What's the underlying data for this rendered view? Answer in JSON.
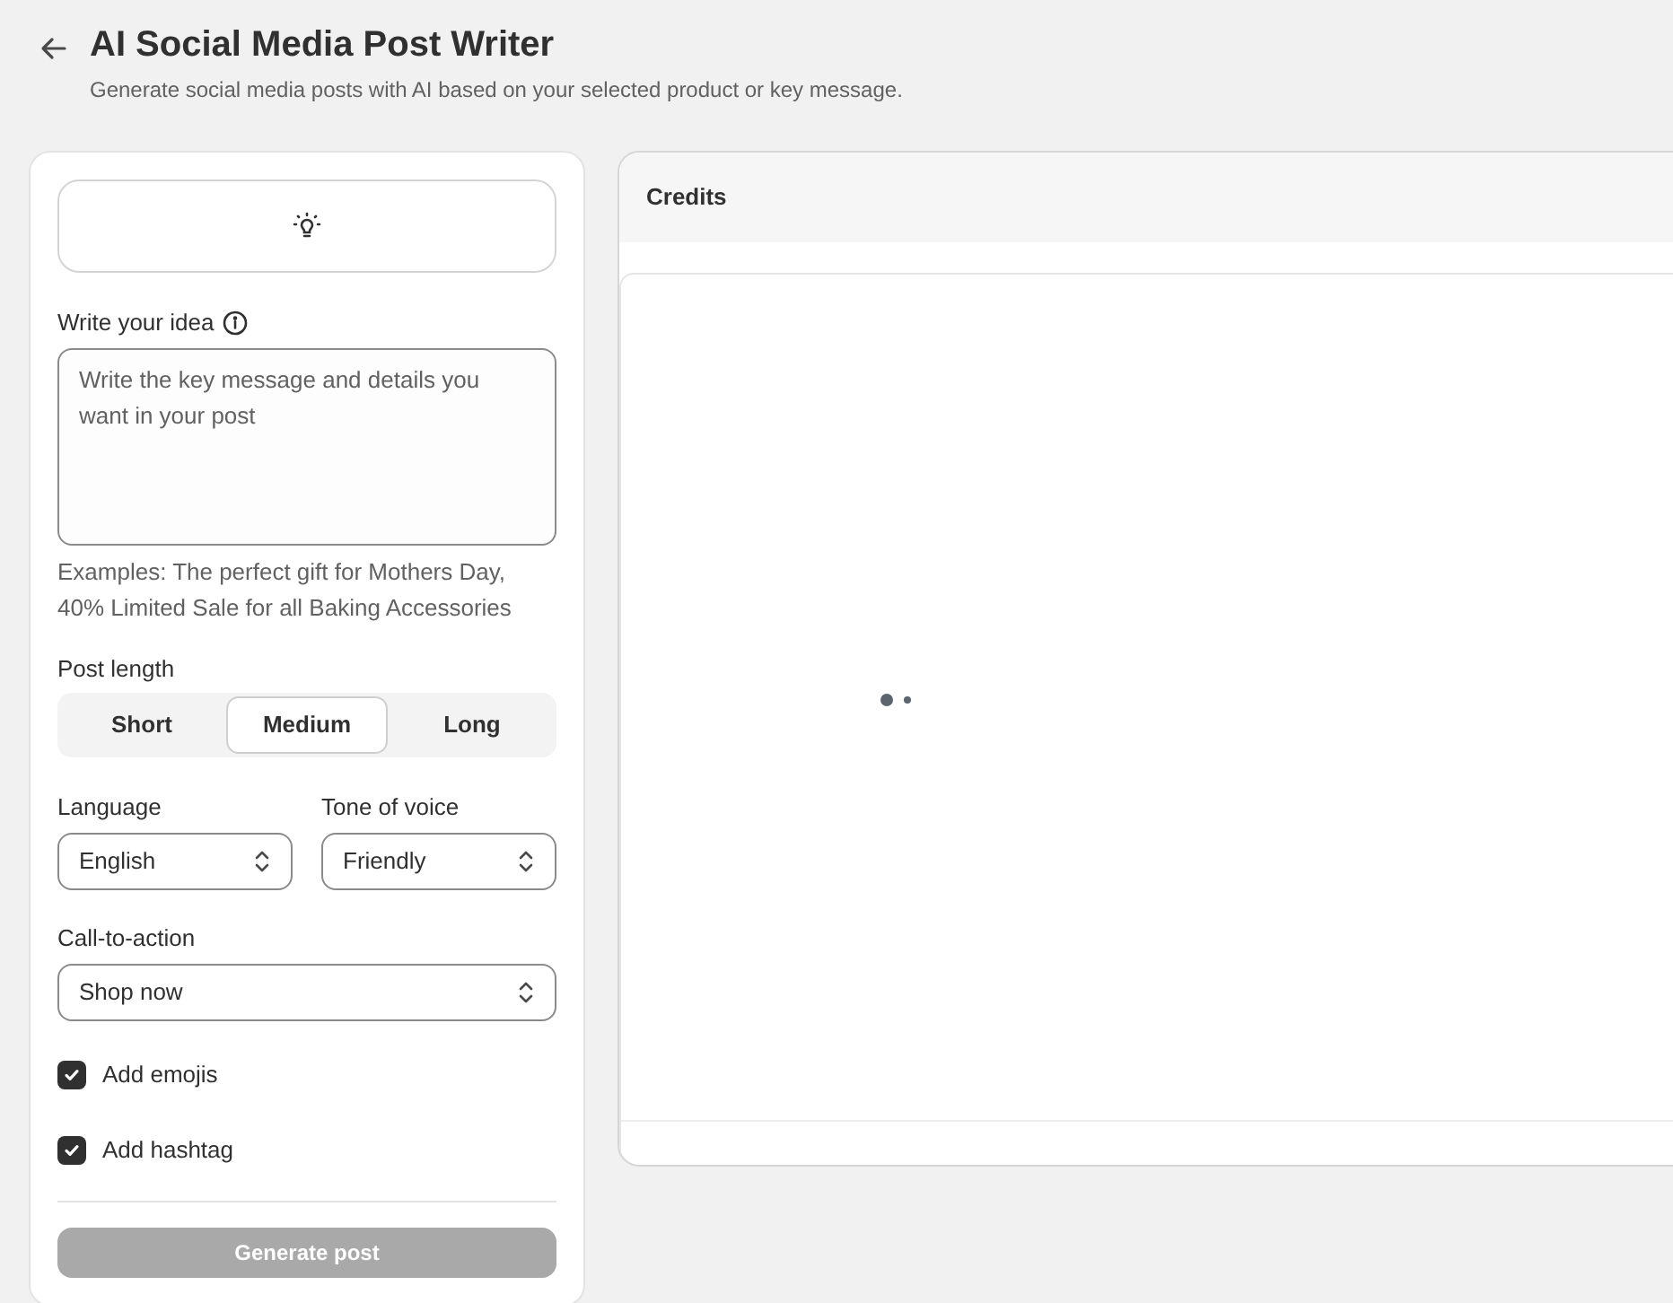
{
  "header": {
    "title": "AI Social Media Post Writer",
    "subtitle": "Generate social media posts with AI based on your selected product or key message."
  },
  "form": {
    "idea": {
      "label": "Write your idea",
      "placeholder": "Write the key message and details you want in your post",
      "examples": "Examples: The perfect gift for Mothers Day, 40% Limited Sale for all Baking Accessories"
    },
    "post_length": {
      "label": "Post length",
      "options": [
        {
          "label": "Short",
          "selected": false
        },
        {
          "label": "Medium",
          "selected": true
        },
        {
          "label": "Long",
          "selected": false
        }
      ]
    },
    "language": {
      "label": "Language",
      "value": "English"
    },
    "tone": {
      "label": "Tone of voice",
      "value": "Friendly"
    },
    "cta": {
      "label": "Call-to-action",
      "value": "Shop now"
    },
    "checkboxes": [
      {
        "label": "Add emojis",
        "checked": true
      },
      {
        "label": "Add hashtag",
        "checked": true
      }
    ],
    "generate": {
      "label": "Generate post",
      "disabled": true
    }
  },
  "preview": {
    "title": "Credits",
    "loading": true
  }
}
